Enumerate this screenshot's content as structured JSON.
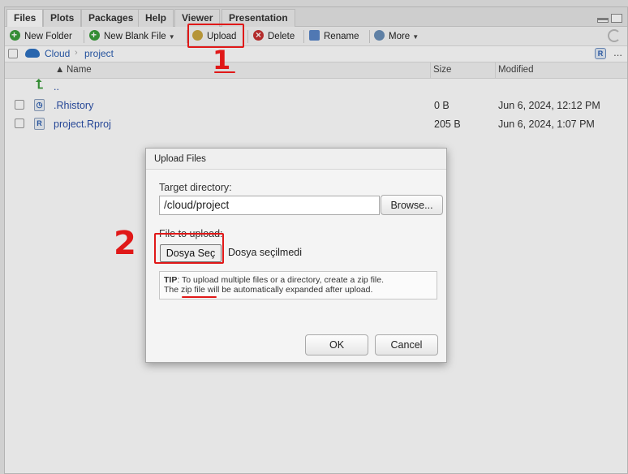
{
  "tabs": [
    "Files",
    "Plots",
    "Packages",
    "Help",
    "Viewer",
    "Presentation"
  ],
  "toolbar": {
    "new_folder": "New Folder",
    "new_blank_file": "New Blank File",
    "upload": "Upload",
    "delete": "Delete",
    "rename": "Rename",
    "more": "More"
  },
  "breadcrumb": {
    "root": "Cloud",
    "current": "project",
    "ellipsis": "..."
  },
  "table": {
    "headers": {
      "name": "Name",
      "size": "Size",
      "modified": "Modified"
    },
    "parent_link": "..",
    "rows": [
      {
        "name": ".Rhistory",
        "size": "0 B",
        "modified": "Jun 6, 2024, 12:12 PM"
      },
      {
        "name": "project.Rproj",
        "size": "205 B",
        "modified": "Jun 6, 2024, 1:07 PM"
      }
    ]
  },
  "dialog": {
    "title": "Upload Files",
    "target_label": "Target directory:",
    "target_value": "/cloud/project",
    "browse": "Browse...",
    "file_label": "File to upload:",
    "choose_file": "Dosya Seç",
    "no_file": "Dosya seçilmedi",
    "tip_bold": "TIP",
    "tip_line1": ": To upload multiple files or a directory, create a zip file.",
    "tip_line2_pre": "The ",
    "tip_zip": "zip file",
    "tip_line2_post": " will be automatically expanded after upload.",
    "ok": "OK",
    "cancel": "Cancel"
  },
  "annotations": {
    "one": "1",
    "two": "2",
    "color": "#e01818"
  }
}
